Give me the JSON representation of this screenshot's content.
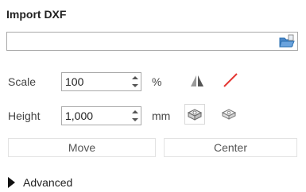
{
  "panel": {
    "title": "Import DXF",
    "file_path": ""
  },
  "scale": {
    "label": "Scale",
    "value": "100",
    "unit": "%"
  },
  "height": {
    "label": "Height",
    "value": "1,000",
    "unit": "mm"
  },
  "buttons": {
    "move": "Move",
    "center": "Center"
  },
  "advanced": {
    "label": "Advanced"
  },
  "icons": {
    "folder": "folder-open-icon",
    "mirror": "mirror-icon",
    "line": "diagonal-line-icon",
    "extrude_solid": "extrude-solid-icon",
    "extrude_hollow": "extrude-hollow-icon"
  },
  "colors": {
    "line_icon": "#e53935",
    "folder_icon": "#2a6fb0"
  }
}
